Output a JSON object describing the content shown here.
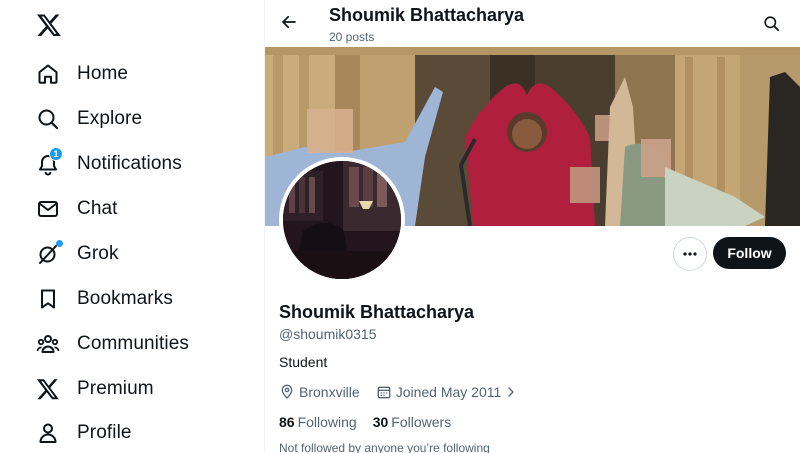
{
  "sidebar": {
    "logo": "x-logo-icon",
    "items": [
      {
        "label": "Home",
        "icon": "home-icon"
      },
      {
        "label": "Explore",
        "icon": "search-icon"
      },
      {
        "label": "Notifications",
        "icon": "bell-icon",
        "badge": "1"
      },
      {
        "label": "Chat",
        "icon": "envelope-icon"
      },
      {
        "label": "Grok",
        "icon": "grok-icon"
      },
      {
        "label": "Bookmarks",
        "icon": "bookmark-icon"
      },
      {
        "label": "Communities",
        "icon": "communities-icon"
      },
      {
        "label": "Premium",
        "icon": "x-logo-icon"
      },
      {
        "label": "Profile",
        "icon": "person-icon"
      }
    ]
  },
  "header": {
    "title": "Shoumik Bhattacharya",
    "subtitle": "20 posts"
  },
  "profile": {
    "name": "Shoumik Bhattacharya",
    "handle": "@shoumik0315",
    "bio": "Student",
    "location": "Bronxville",
    "joined": "Joined May 2011",
    "following_count": "86",
    "following_label": "Following",
    "followers_count": "30",
    "followers_label": "Followers",
    "follow_button": "Follow",
    "mutuals_note": "Not followed by anyone you’re following"
  },
  "colors": {
    "accent": "#1d9bf0",
    "text_primary": "#0f1419",
    "text_secondary": "#536471",
    "follow_bg": "#0f1419"
  }
}
